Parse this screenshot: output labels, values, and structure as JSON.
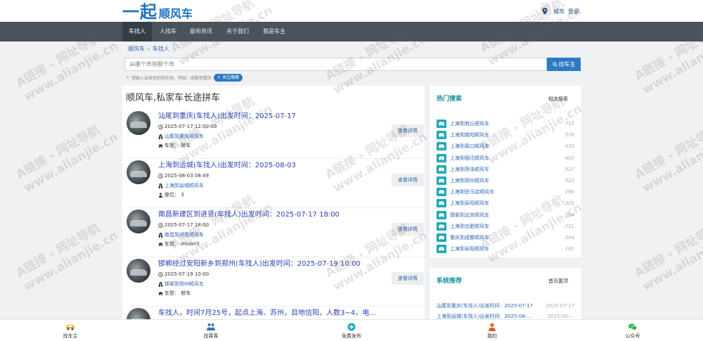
{
  "header": {
    "logo_main": "一起",
    "logo_sub": "顺风车",
    "city_label": "城市",
    "login_label": "登录"
  },
  "nav": {
    "items": [
      {
        "label": "车找人",
        "active": true
      },
      {
        "label": "人找车",
        "active": false
      },
      {
        "label": "最新资讯",
        "active": false
      },
      {
        "label": "关于我们",
        "active": false
      },
      {
        "label": "我是车主",
        "active": false
      }
    ]
  },
  "breadcrumb": {
    "home": "顺风车",
    "separator": "»",
    "current": "车找人"
  },
  "search": {
    "placeholder": "从哪个市到那个市",
    "button_label": "找车主",
    "hint": "请输入出发地到目的地。例如：成都到重庆",
    "hint_tag": "+ 关注路路"
  },
  "listing": {
    "title": "顺风车,私家车长途拼车",
    "detail_label": "查看详情",
    "items": [
      {
        "title": "汕尾到重庆(车找人)出发时间：2025-07-17",
        "time": "2025-07-17 12:00:00",
        "route": "汕尾到重庆顺风车",
        "extra": "车型：  轿车"
      },
      {
        "title": "上海到运城(车找人)出发时间：2025-08-03",
        "time": "2025-08-03 08:49",
        "route": "上海到运城顺风车",
        "extra": "座位：  3"
      },
      {
        "title": "南昌新建区到进贤(车找人)出发时间：2025-07-17 18:00",
        "time": "2025-07-17 18:00",
        "route": "南昌到进贤顺风车",
        "extra": "车型：  model3"
      },
      {
        "title": "邯郸经过安阳新乡到郑州(车找人)出发时间：2025-07-19 10:00",
        "time": "2025-07-19 10:00",
        "route": "邯郸到郑州顺风车",
        "extra": "车型：  轿车"
      },
      {
        "title": "车找人，时间7月25号，起点上海、苏州，目地信阳，人数3~4，电...",
        "time": "",
        "route": "",
        "extra": ""
      }
    ]
  },
  "hot": {
    "title": "热门搜索",
    "more": "相关搜索",
    "items": [
      {
        "label": "上海到商丘顺风车",
        "count": "715"
      },
      {
        "label": "上海到南阳顺风车",
        "count": "578"
      },
      {
        "label": "上海到周口顺风车",
        "count": "433"
      },
      {
        "label": "上海到宿迁顺风车",
        "count": "402"
      },
      {
        "label": "上海到菏泽顺风车",
        "count": "327"
      },
      {
        "label": "上海到郑州顺风车",
        "count": "323"
      },
      {
        "label": "上海到驻马店顺风车",
        "count": "269"
      },
      {
        "label": "上海到阜阳顺风车",
        "count": "225"
      },
      {
        "label": "邯郸到北京顺风车",
        "count": "224"
      },
      {
        "label": "上海到合肥顺风车",
        "count": "221"
      },
      {
        "label": "重庆到成都顺风车",
        "count": "204"
      },
      {
        "label": "上海到阜阳顺风车",
        "count": "191"
      }
    ]
  },
  "recommend": {
    "title": "系统推荐",
    "more": "首页置顶",
    "items": [
      {
        "label": "汕尾到重庆(车找人)出发时间：2025-07-17",
        "date": "2025-07-17"
      },
      {
        "label": "上海到运城(车找人)出发时间：2025-08-...",
        "date": "2025-05-..."
      }
    ]
  },
  "bottom_tabs": [
    {
      "label": "找车主",
      "icon": "car-icon"
    },
    {
      "label": "找乘客",
      "icon": "passengers-icon"
    },
    {
      "label": "免费发布",
      "icon": "plus-circle-icon"
    },
    {
      "label": "我的",
      "icon": "person-icon"
    },
    {
      "label": "公众号",
      "icon": "wechat-icon"
    }
  ],
  "watermark": {
    "line1": "A链接 - 网址导航",
    "line2": "www.alianjie.cn"
  },
  "colors": {
    "brand_blue": "#1d6fbf",
    "nav_dark": "#4a535c",
    "nav_active": "#353d45",
    "teal": "#22a8b7",
    "link_blue": "#2a63b2",
    "title_blue": "#2a3fb1"
  }
}
